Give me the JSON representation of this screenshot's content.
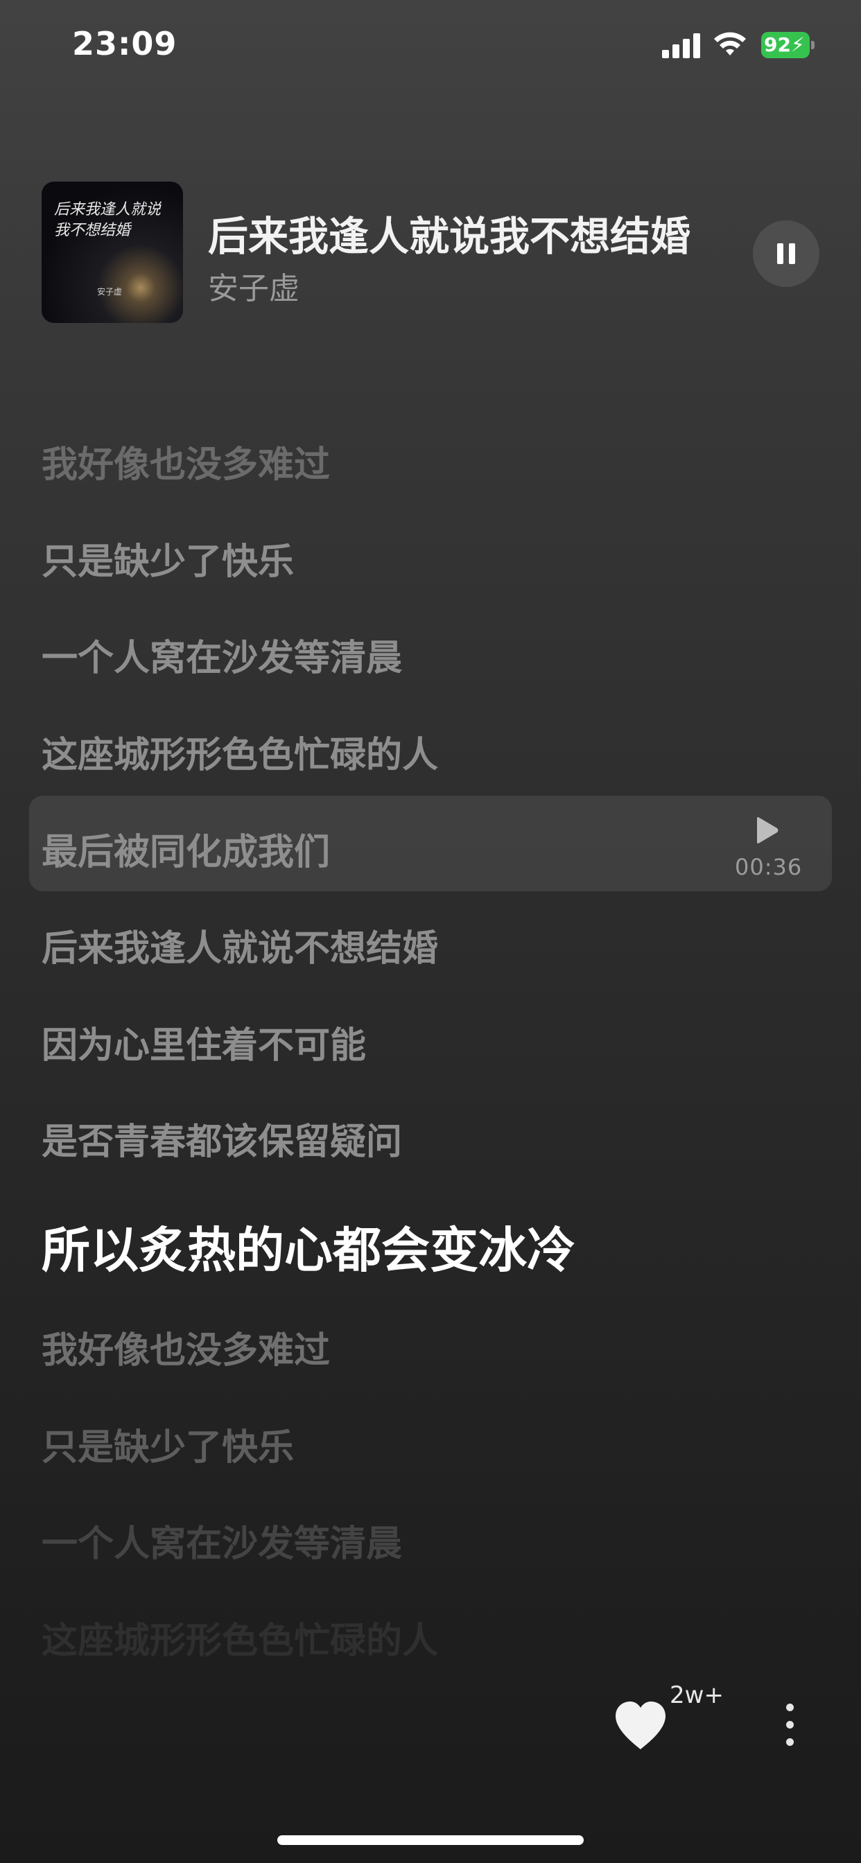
{
  "status_bar": {
    "time": "23:09",
    "battery_percent": "92",
    "icons": [
      "signal-icon",
      "wifi-icon",
      "battery-icon",
      "charging-bolt-icon"
    ]
  },
  "now_playing": {
    "title": "后来我逢人就说我不想结婚",
    "artist": "安子虚",
    "album_art_text": "后来我逢人就说我不想结婚",
    "album_art_artist": "安子虚",
    "play_state_icon": "pause-icon",
    "is_playing": true
  },
  "lyrics": [
    {
      "text": "我好像也没多难过",
      "state": "faded"
    },
    {
      "text": "只是缺少了快乐",
      "state": "normal"
    },
    {
      "text": "一个人窝在沙发等清晨",
      "state": "normal"
    },
    {
      "text": "这座城形形色色忙碌的人",
      "state": "normal"
    },
    {
      "text": "最后被同化成我们",
      "state": "seek"
    },
    {
      "text": "后来我逢人就说不想结婚",
      "state": "normal"
    },
    {
      "text": "因为心里住着不可能",
      "state": "normal"
    },
    {
      "text": "是否青春都该保留疑问",
      "state": "normal"
    },
    {
      "text": "所以炙热的心都会变冰冷",
      "state": "current"
    },
    {
      "text": "我好像也没多难过",
      "state": "upcoming"
    },
    {
      "text": "只是缺少了快乐",
      "state": "upcoming"
    },
    {
      "text": "一个人窝在沙发等清晨",
      "state": "dim"
    },
    {
      "text": "这座城形形色色忙碌的人",
      "state": "dimmer"
    }
  ],
  "seek": {
    "time": "00:36",
    "icon": "play-icon"
  },
  "actions": {
    "like_icon": "heart-icon",
    "like_count": "2w+",
    "more_icon": "more-vertical-icon"
  },
  "colors": {
    "accent_battery": "#36c24f",
    "current_lyric": "#ffffff",
    "normal_lyric": "#8e8e8e"
  }
}
